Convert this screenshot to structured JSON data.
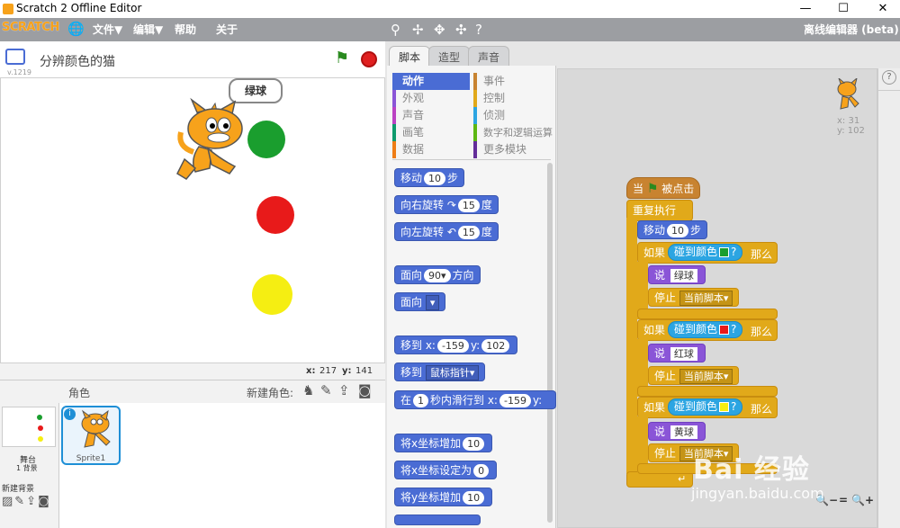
{
  "window": {
    "title": "Scratch 2 Offline Editor",
    "minimize": "—",
    "maximize": "☐",
    "close": "✕"
  },
  "menubar": {
    "logo": "SCRATCH",
    "items": [
      "文件▼",
      "编辑▼",
      "帮助",
      "关于"
    ],
    "right_label": "离线编辑器 (beta)",
    "tools": [
      "stamp-icon",
      "cut-icon",
      "grow-icon",
      "shrink-icon",
      "help-icon"
    ]
  },
  "stage": {
    "project_title": "分辨颜色的猫",
    "version": "v.1219",
    "speech": "绿球",
    "coords": {
      "x_label": "x:",
      "x": "217",
      "y_label": "y:",
      "y": "141"
    },
    "balls": {
      "green": "#1a9e2e",
      "red": "#e81a1a",
      "yellow": "#f5ee12"
    }
  },
  "sprites": {
    "header": "角色",
    "new_sprite": "新建角色:",
    "stage_label": "舞台",
    "backdrops": "1 背景",
    "new_backdrop": "新建背景",
    "sprite_name": "Sprite1"
  },
  "tabs": [
    "脚本",
    "造型",
    "声音"
  ],
  "categories": {
    "left": [
      {
        "label": "动作",
        "color": "#4a6cd4",
        "active": true
      },
      {
        "label": "外观",
        "color": "#8a55d7"
      },
      {
        "label": "声音",
        "color": "#bb42c3"
      },
      {
        "label": "画笔",
        "color": "#0e9a6c"
      },
      {
        "label": "数据",
        "color": "#ee7d16"
      }
    ],
    "right": [
      {
        "label": "事件",
        "color": "#c88330"
      },
      {
        "label": "控制",
        "color": "#e1a91a"
      },
      {
        "label": "侦测",
        "color": "#2ca5e2"
      },
      {
        "label": "数字和逻辑运算",
        "color": "#5cb712"
      },
      {
        "label": "更多模块",
        "color": "#632d99"
      }
    ]
  },
  "palette": {
    "move": {
      "a": "移动",
      "n": "10",
      "b": "步"
    },
    "turn_right": {
      "a": "向右旋转",
      "icon": "↷",
      "n": "15",
      "b": "度"
    },
    "turn_left": {
      "a": "向左旋转",
      "icon": "↶",
      "n": "15",
      "b": "度"
    },
    "point_dir": {
      "a": "面向",
      "n": "90▾",
      "b": "方向"
    },
    "point_towards": {
      "a": "面向",
      "dd": "▾"
    },
    "goto_xy": {
      "a": "移到 x:",
      "x": "-159",
      "b": "y:",
      "y": "102"
    },
    "goto": {
      "a": "移到",
      "dd": "鼠标指针▾"
    },
    "glide": {
      "a": "在",
      "n": "1",
      "b": "秒内滑行到 x:",
      "x": "-159",
      "c": "y:"
    },
    "change_x": {
      "a": "将x坐标增加",
      "n": "10"
    },
    "set_x": {
      "a": "将x坐标设定为",
      "n": "0"
    },
    "change_y": {
      "a": "将y坐标增加",
      "n": "10"
    }
  },
  "script": {
    "hat": {
      "a": "当",
      "b": "被点击"
    },
    "forever": "重复执行",
    "move": {
      "a": "移动",
      "n": "10",
      "b": "步"
    },
    "if_label": "如果",
    "then_label": "那么",
    "touching": "碰到颜色",
    "q": "?",
    "say_label": "说",
    "stop_label": "停止",
    "stop_opt": "当前脚本▾",
    "branches": [
      {
        "color": "#1a9e2e",
        "say": "绿球"
      },
      {
        "color": "#e81a1a",
        "say": "红球"
      },
      {
        "color": "#f5ee12",
        "say": "黄球"
      }
    ],
    "sprite_info": {
      "x": "x: 31",
      "y": "y: 102"
    },
    "zoom": [
      "🔍−",
      "=",
      "🔍+"
    ]
  },
  "watermark": {
    "brand": "Bai  经验",
    "url": "jingyan.baidu.com"
  }
}
